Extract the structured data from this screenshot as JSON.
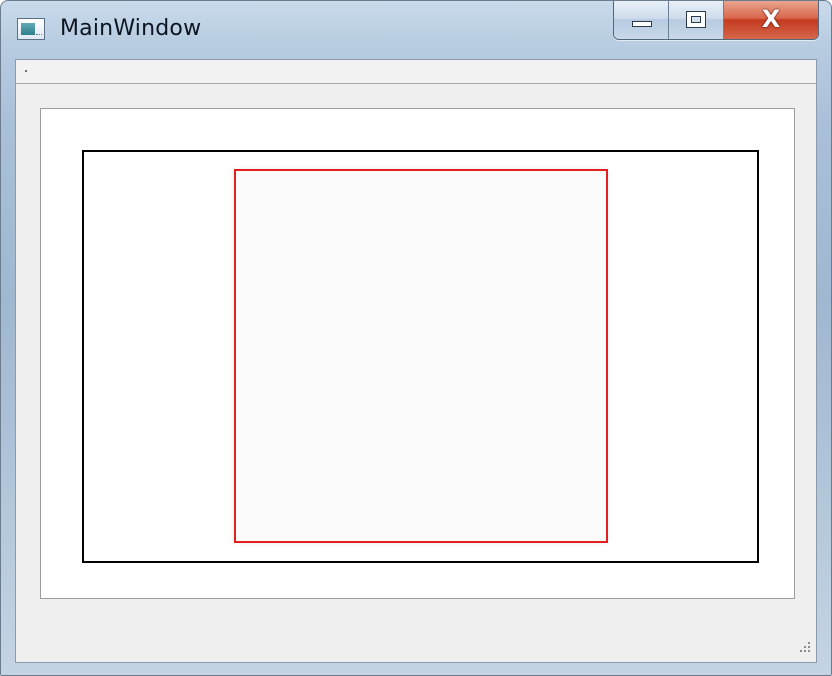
{
  "window": {
    "title": "MainWindow"
  },
  "titlebar": {
    "app_icon": "app-window-icon",
    "buttons": {
      "minimize": "minimize-icon",
      "maximize": "maximize-icon",
      "close": "close-icon",
      "close_glyph": "X"
    }
  },
  "colors": {
    "outer_border": "#000000",
    "inner_border": "#e31f1f",
    "close_button": "#c43a1f"
  }
}
